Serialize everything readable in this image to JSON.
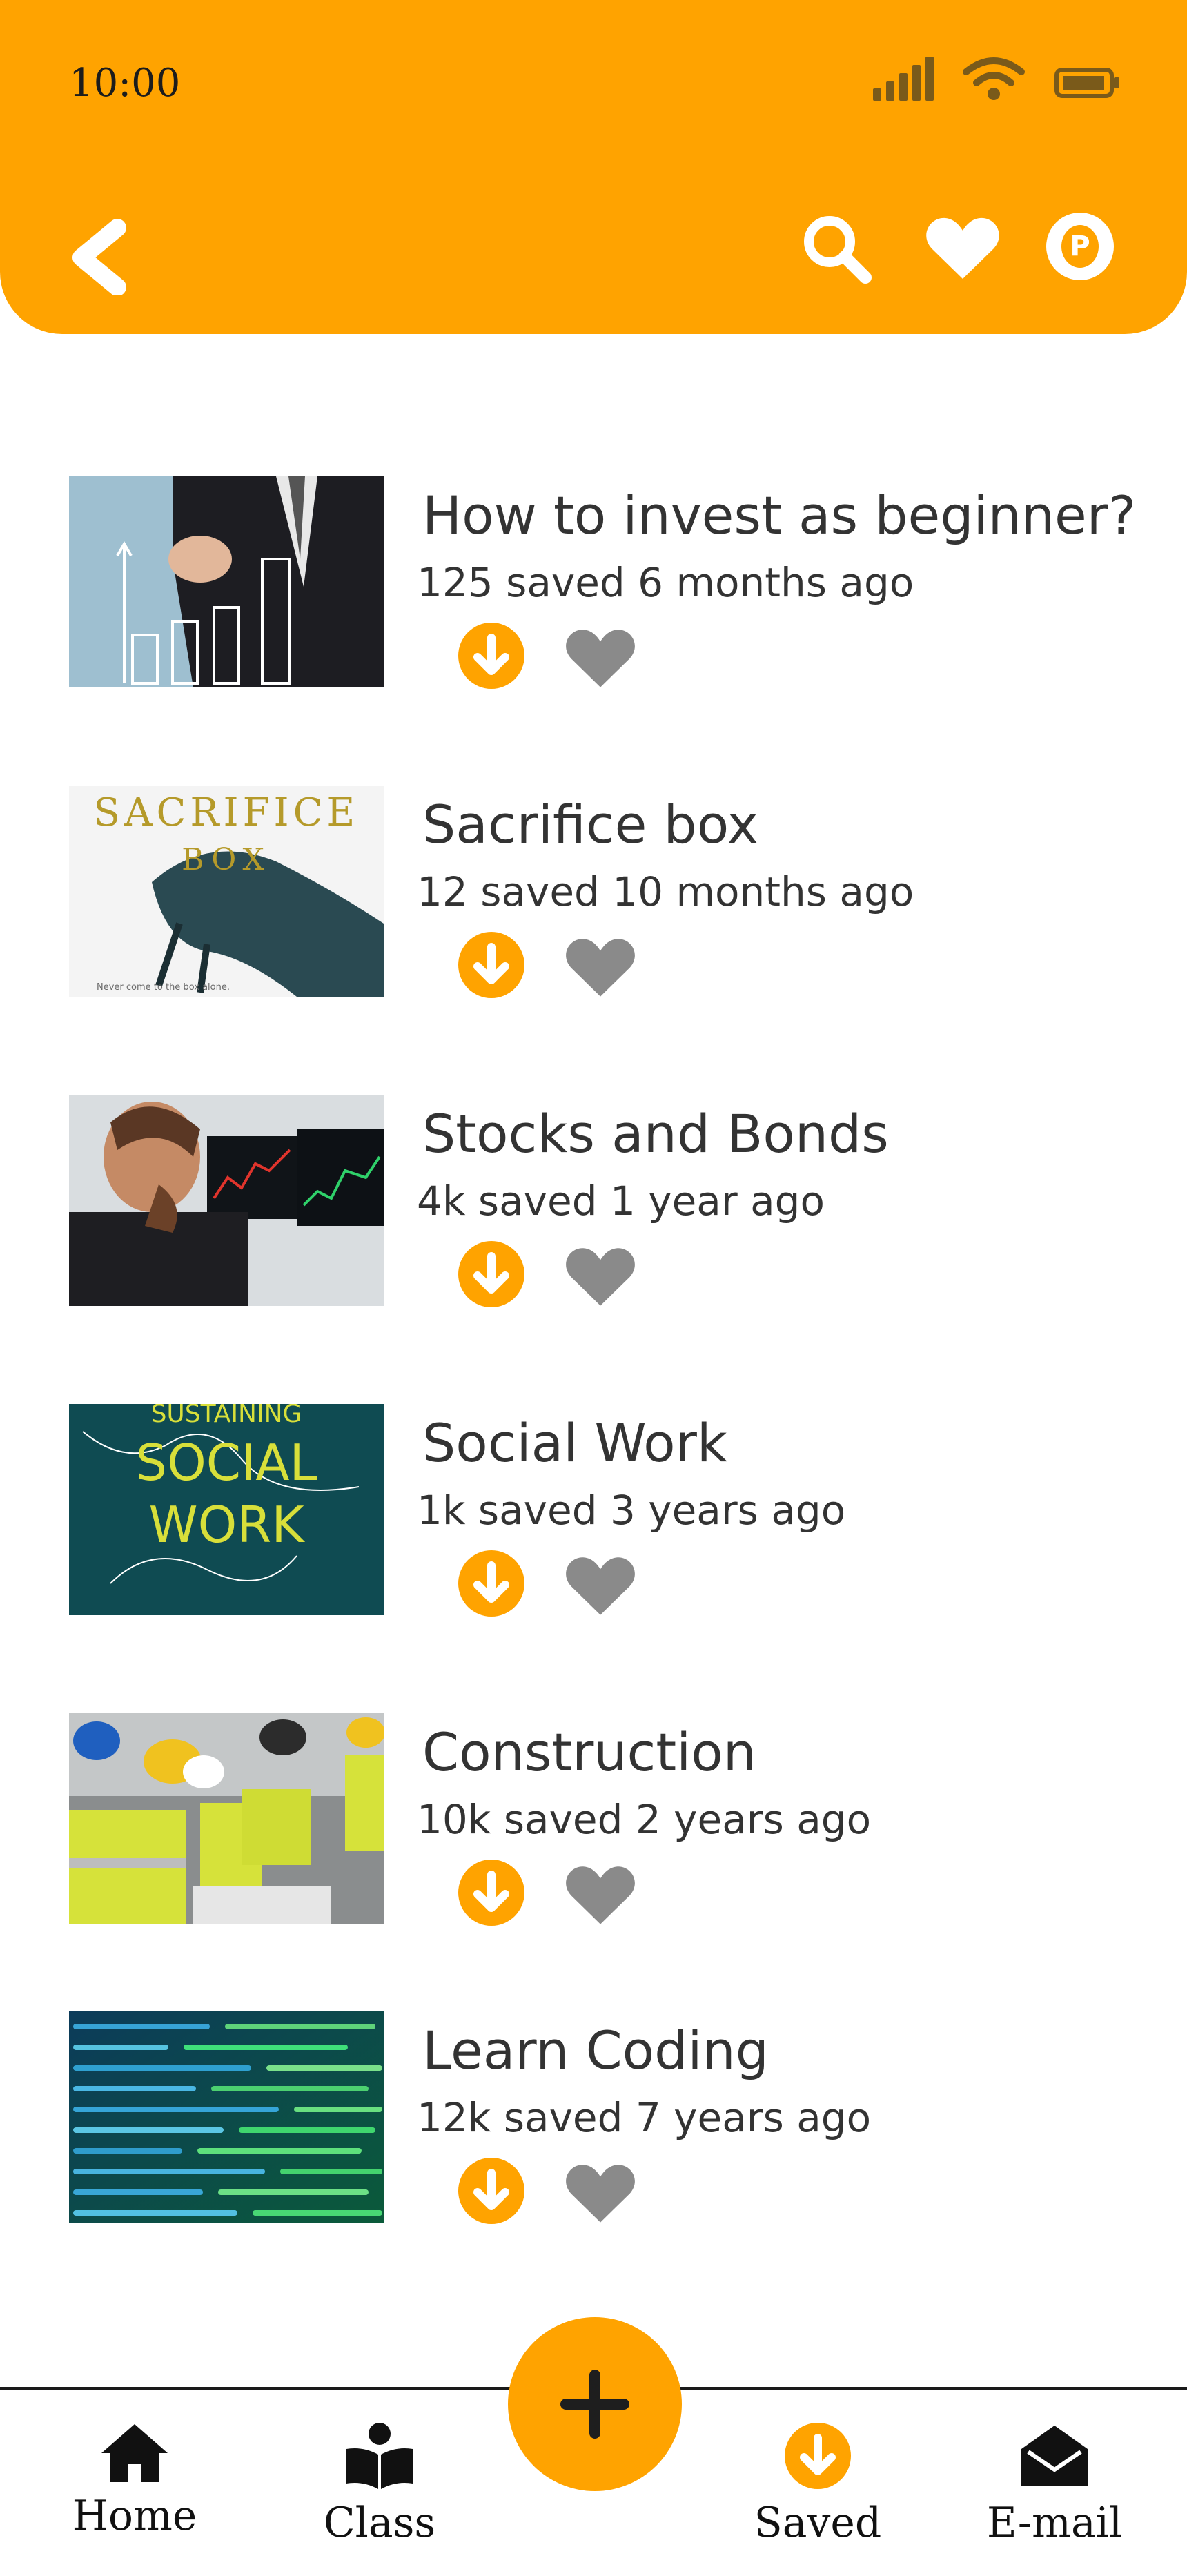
{
  "status_bar": {
    "time": "10:00"
  },
  "header": {
    "back_icon": "chevron-left-icon",
    "search_icon": "search-icon",
    "favorites_icon": "heart-icon",
    "profile_icon": "p-badge-icon"
  },
  "colors": {
    "accent": "#FFA300",
    "text": "#333333",
    "heart_gray": "#8a8a8a"
  },
  "items": [
    {
      "title": "How to invest as beginner?",
      "meta": "125 saved 6 months ago"
    },
    {
      "title": "Sacrifice box",
      "meta": "12 saved 10 months ago",
      "thumb_text": [
        "SACRIFICE",
        "BOX",
        "Never come to the box alone."
      ]
    },
    {
      "title": "Stocks and Bonds",
      "meta": "4k saved 1 year ago"
    },
    {
      "title": "Social Work",
      "meta": "1k saved 3 years ago",
      "thumb_text": [
        "SUSTAINING",
        "SOCIAL",
        "WORK"
      ]
    },
    {
      "title": "Construction",
      "meta": "10k saved 2 years ago"
    },
    {
      "title": "Learn Coding",
      "meta": "12k saved 7 years ago"
    }
  ],
  "bottom_nav": {
    "home": "Home",
    "class": "Class",
    "saved": "Saved",
    "email": "E-mail",
    "add_icon": "plus-icon"
  }
}
